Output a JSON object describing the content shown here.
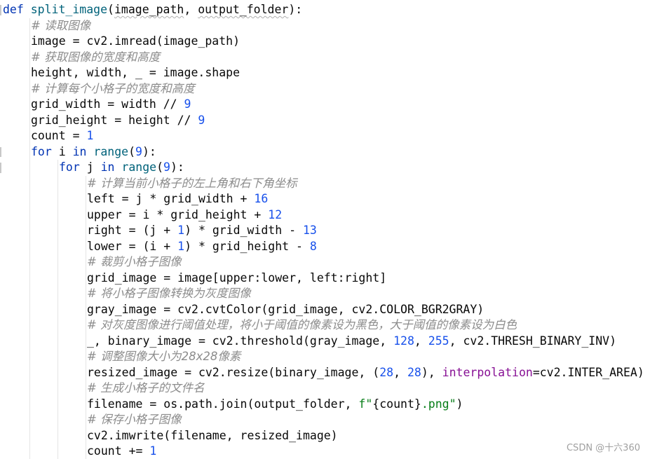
{
  "editor": {
    "lines": [
      {
        "indent": 0,
        "tokens": [
          [
            "kw",
            "def "
          ],
          [
            "fn",
            "split_image"
          ],
          [
            "pl",
            "("
          ],
          [
            "ul",
            "image_path"
          ],
          [
            "pl",
            ", "
          ],
          [
            "ul",
            "output_folder"
          ],
          [
            "pl",
            "):"
          ]
        ]
      },
      {
        "indent": 1,
        "tokens": [
          [
            "cm",
            "# 读取图像"
          ]
        ]
      },
      {
        "indent": 1,
        "tokens": [
          [
            "pl",
            "image = cv2.imread(image_path)"
          ]
        ]
      },
      {
        "indent": 1,
        "tokens": [
          [
            "cm",
            "# 获取图像的宽度和高度"
          ]
        ]
      },
      {
        "indent": 1,
        "tokens": [
          [
            "pl",
            "height, width, _ = image.shape"
          ]
        ]
      },
      {
        "indent": 1,
        "tokens": [
          [
            "cm",
            "# 计算每个小格子的宽度和高度"
          ]
        ]
      },
      {
        "indent": 1,
        "tokens": [
          [
            "pl",
            "grid_width = width // "
          ],
          [
            "num",
            "9"
          ]
        ]
      },
      {
        "indent": 1,
        "tokens": [
          [
            "pl",
            "grid_height = height // "
          ],
          [
            "num",
            "9"
          ]
        ]
      },
      {
        "indent": 1,
        "tokens": [
          [
            "pl",
            "count = "
          ],
          [
            "num",
            "1"
          ]
        ]
      },
      {
        "indent": 1,
        "tokens": [
          [
            "kw",
            "for "
          ],
          [
            "pl",
            "i "
          ],
          [
            "kw",
            "in "
          ],
          [
            "fn",
            "range"
          ],
          [
            "pl",
            "("
          ],
          [
            "num",
            "9"
          ],
          [
            "pl",
            "):"
          ]
        ]
      },
      {
        "indent": 2,
        "tokens": [
          [
            "kw",
            "for "
          ],
          [
            "pl",
            "j "
          ],
          [
            "kw",
            "in "
          ],
          [
            "fn",
            "range"
          ],
          [
            "pl",
            "("
          ],
          [
            "num",
            "9"
          ],
          [
            "pl",
            "):"
          ]
        ]
      },
      {
        "indent": 3,
        "tokens": [
          [
            "cm",
            "# 计算当前小格子的左上角和右下角坐标"
          ]
        ]
      },
      {
        "indent": 3,
        "tokens": [
          [
            "pl",
            "left = j * grid_width + "
          ],
          [
            "num",
            "16"
          ]
        ]
      },
      {
        "indent": 3,
        "tokens": [
          [
            "pl",
            "upper = i * grid_height + "
          ],
          [
            "num",
            "12"
          ]
        ]
      },
      {
        "indent": 3,
        "tokens": [
          [
            "pl",
            "right = (j + "
          ],
          [
            "num",
            "1"
          ],
          [
            "pl",
            ") * grid_width - "
          ],
          [
            "num",
            "13"
          ]
        ]
      },
      {
        "indent": 3,
        "tokens": [
          [
            "pl",
            "lower = (i + "
          ],
          [
            "num",
            "1"
          ],
          [
            "pl",
            ") * grid_height - "
          ],
          [
            "num",
            "8"
          ]
        ]
      },
      {
        "indent": 3,
        "tokens": [
          [
            "cm",
            "# 裁剪小格子图像"
          ]
        ]
      },
      {
        "indent": 3,
        "tokens": [
          [
            "pl",
            "grid_image = image[upper:lower, left:right]"
          ]
        ]
      },
      {
        "indent": 3,
        "tokens": [
          [
            "cm",
            "# 将小格子图像转换为灰度图像"
          ]
        ]
      },
      {
        "indent": 3,
        "tokens": [
          [
            "pl",
            "gray_image = cv2.cvtColor(grid_image, cv2.COLOR_BGR2GRAY)"
          ]
        ]
      },
      {
        "indent": 3,
        "tokens": [
          [
            "cm",
            "# 对灰度图像进行阈值处理，将小于阈值的像素设为黑色，大于阈值的像素设为白色"
          ]
        ]
      },
      {
        "indent": 3,
        "tokens": [
          [
            "pl",
            "_, binary_image = cv2.threshold(gray_image, "
          ],
          [
            "num",
            "128"
          ],
          [
            "pl",
            ", "
          ],
          [
            "num",
            "255"
          ],
          [
            "pl",
            ", cv2.THRESH_BINARY_INV)"
          ]
        ]
      },
      {
        "indent": 3,
        "tokens": [
          [
            "cm",
            "# 调整图像大小为28x28像素"
          ]
        ]
      },
      {
        "indent": 3,
        "tokens": [
          [
            "pl",
            "resized_image = cv2.resize(binary_image, ("
          ],
          [
            "num",
            "28"
          ],
          [
            "pl",
            ", "
          ],
          [
            "num",
            "28"
          ],
          [
            "pl",
            "), "
          ],
          [
            "param",
            "interpolation"
          ],
          [
            "pl",
            "=cv2.INTER_AREA)"
          ]
        ]
      },
      {
        "indent": 3,
        "tokens": [
          [
            "cm",
            "# 生成小格子的文件名"
          ]
        ]
      },
      {
        "indent": 3,
        "tokens": [
          [
            "pl",
            "filename = os.path.join(output_folder, "
          ],
          [
            "str",
            "f\""
          ],
          [
            "pl",
            "{count}"
          ],
          [
            "str",
            ".png\""
          ],
          [
            "pl",
            ")"
          ]
        ]
      },
      {
        "indent": 3,
        "tokens": [
          [
            "cm",
            "# 保存小格子图像"
          ]
        ]
      },
      {
        "indent": 3,
        "tokens": [
          [
            "pl",
            "cv2.imwrite(filename, resized_image)"
          ]
        ]
      },
      {
        "indent": 3,
        "tokens": [
          [
            "pl",
            "count += "
          ],
          [
            "num",
            "1"
          ]
        ]
      }
    ]
  },
  "watermark": {
    "text": "CSDN @十六360"
  },
  "colors": {
    "keyword": "#0033b3",
    "function": "#00627a",
    "number": "#1750eb",
    "string": "#067d17",
    "comment": "#8c8c8c",
    "parameter": "#871094",
    "plain": "#080808"
  }
}
